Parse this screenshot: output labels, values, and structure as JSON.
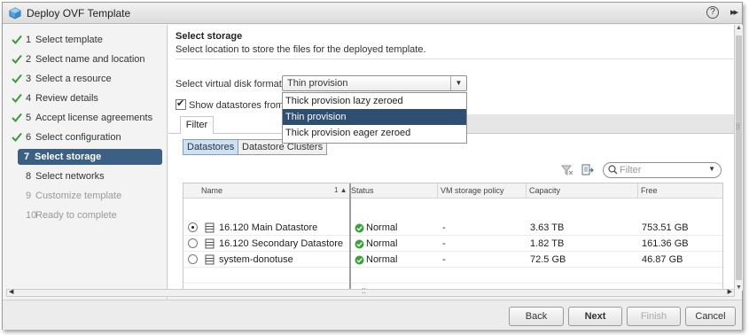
{
  "window": {
    "title": "Deploy OVF Template",
    "help_label": "?",
    "expand_label": "▸▸"
  },
  "steps": [
    {
      "num": "1",
      "label": "Select template",
      "state": "done"
    },
    {
      "num": "2",
      "label": "Select name and location",
      "state": "done"
    },
    {
      "num": "3",
      "label": "Select a resource",
      "state": "done"
    },
    {
      "num": "4",
      "label": "Review details",
      "state": "done"
    },
    {
      "num": "5",
      "label": "Accept license agreements",
      "state": "done"
    },
    {
      "num": "6",
      "label": "Select configuration",
      "state": "done"
    },
    {
      "num": "7",
      "label": "Select storage",
      "state": "active"
    },
    {
      "num": "8",
      "label": "Select networks",
      "state": "pending"
    },
    {
      "num": "9",
      "label": "Customize template",
      "state": "disabled"
    },
    {
      "num": "10",
      "label": "Ready to complete",
      "state": "disabled"
    }
  ],
  "section": {
    "title": "Select storage",
    "description": "Select location to store the files for the deployed template."
  },
  "disk_format": {
    "label": "Select virtual disk format:",
    "value": "Thin provision",
    "options": [
      "Thick provision lazy zeroed",
      "Thin provision",
      "Thick provision eager zeroed"
    ]
  },
  "show_datastores": {
    "label": "Show datastores from",
    "checked": true
  },
  "filter_tab": "Filter",
  "view_toggle": {
    "datastores": "Datastores",
    "clusters": "Datastore Clusters"
  },
  "filter_input": {
    "placeholder": "Filter"
  },
  "table": {
    "columns": [
      "Name",
      "Status",
      "VM storage policy",
      "Capacity",
      "Free"
    ],
    "sort_indicator": "1 ▲",
    "rows": [
      {
        "name": "16.120 Main Datastore",
        "status": "Normal",
        "policy": "-",
        "capacity": "3.63  TB",
        "free": "753.51  GB",
        "selected": true
      },
      {
        "name": "16.120 Secondary Datastore",
        "status": "Normal",
        "policy": "-",
        "capacity": "1.82  TB",
        "free": "161.36  GB",
        "selected": false
      },
      {
        "name": "system-donotuse",
        "status": "Normal",
        "policy": "-",
        "capacity": "72.5  GB",
        "free": "46.87  GB",
        "selected": false
      }
    ]
  },
  "buttons": {
    "back": "Back",
    "next": "Next",
    "finish": "Finish",
    "cancel": "Cancel"
  },
  "colors": {
    "active_step": "#3c5f84",
    "selected_option": "#2f4f72",
    "check_green": "#3a9a3a",
    "status_green": "#3aa23a"
  }
}
